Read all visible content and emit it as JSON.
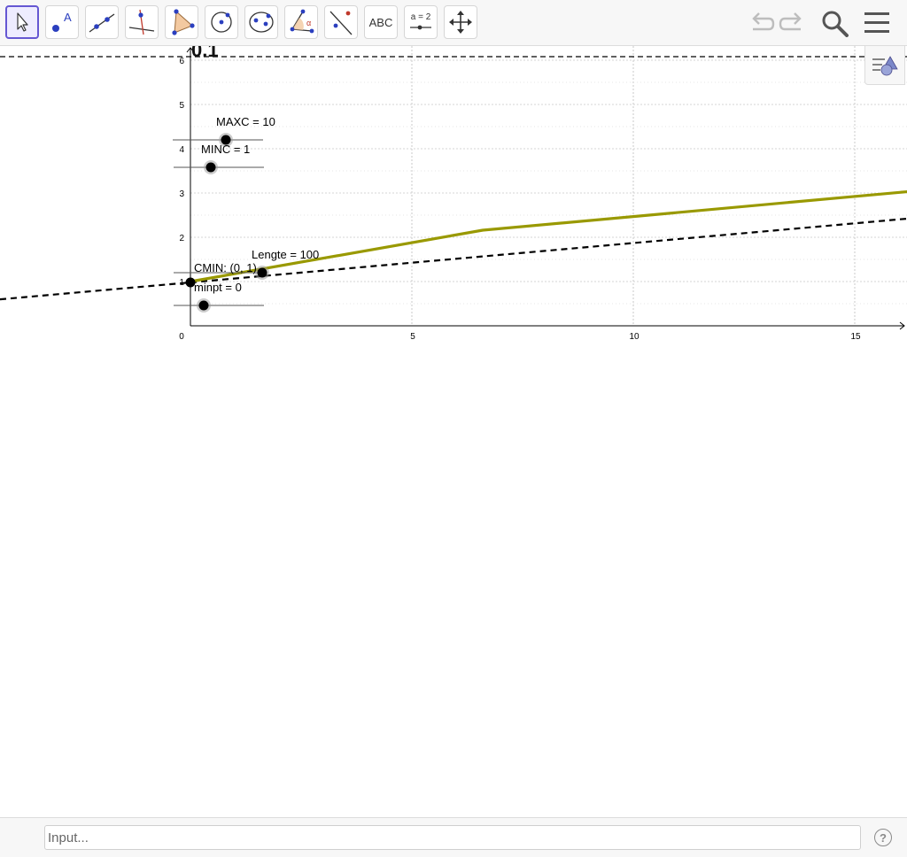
{
  "toolbar": {
    "tools": [
      {
        "name": "move-tool",
        "icon": "arrow-cursor-icon"
      },
      {
        "name": "point-tool",
        "icon": "point-icon"
      },
      {
        "name": "line-tool",
        "icon": "line-through-points-icon"
      },
      {
        "name": "perpendicular-line-tool",
        "icon": "perpendicular-line-icon"
      },
      {
        "name": "polygon-tool",
        "icon": "polygon-icon"
      },
      {
        "name": "circle-tool",
        "icon": "circle-center-point-icon"
      },
      {
        "name": "ellipse-tool",
        "icon": "ellipse-icon"
      },
      {
        "name": "angle-tool",
        "icon": "angle-icon"
      },
      {
        "name": "reflect-tool",
        "icon": "reflect-about-line-icon"
      },
      {
        "name": "text-tool",
        "label": "ABC"
      },
      {
        "name": "slider-tool",
        "label": "a = 2"
      },
      {
        "name": "move-graphics-view-tool",
        "icon": "move-arrows-icon"
      }
    ],
    "right": [
      "undo-icon",
      "redo-icon",
      "search-icon",
      "menu-icon"
    ]
  },
  "graphics": {
    "accent_color": "#999900",
    "x_axis": {
      "min": 0,
      "max": 16.3,
      "ticks": [
        "0",
        "5",
        "10",
        "15"
      ]
    },
    "y_axis": {
      "min": 0,
      "max": 6.2,
      "ticks": [
        "1",
        "2",
        "3",
        "4",
        "5",
        "6"
      ]
    },
    "top_label": "0.1",
    "labels": {
      "maxc": "MAXC = 10",
      "minc": "MINC = 1",
      "lengte": "Lengte = 100",
      "cmin": "CMIN: (0, 1)",
      "minpt": "minpt = 0"
    },
    "sliders": [
      {
        "name": "MAXC",
        "value": 10
      },
      {
        "name": "MINC",
        "value": 1
      },
      {
        "name": "Lengte",
        "value": 100
      },
      {
        "name": "minpt",
        "value": 0
      }
    ],
    "points": [
      {
        "name": "CMIN",
        "x": 0,
        "y": 1
      }
    ],
    "curve_points": [
      [
        0,
        1
      ],
      [
        6.6,
        2.16
      ],
      [
        16.3,
        3.04
      ]
    ],
    "dashed_line": {
      "slope": 0.089,
      "intercept": 0.98
    },
    "horizontal_dashed_y": 6.08
  },
  "input_bar": {
    "placeholder": "Input..."
  },
  "help_icon_label": "?"
}
